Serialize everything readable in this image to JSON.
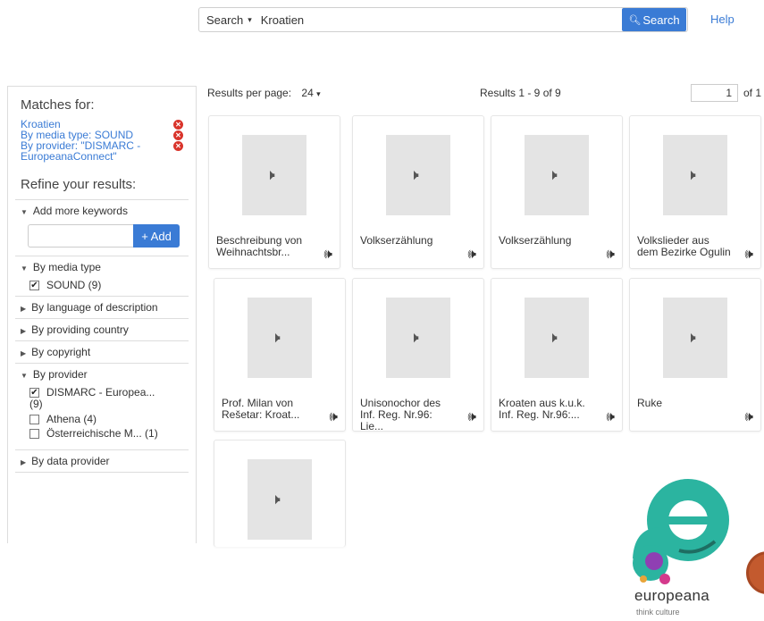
{
  "search": {
    "type_label": "Search",
    "query": "Kroatien",
    "button_label": "Search",
    "help_label": "Help"
  },
  "sidebar": {
    "matches_title": "Matches for:",
    "matches": [
      {
        "label": "Kroatien"
      },
      {
        "label": "By media type: SOUND"
      },
      {
        "label": "By provider: \"DISMARC - EuropeanaConnect\""
      }
    ],
    "refine_title": "Refine your results:",
    "facets": {
      "keywords": {
        "label": "Add more keywords",
        "add_label": "+ Add"
      },
      "media_type": {
        "label": "By media type",
        "options": [
          {
            "label": "SOUND (9)",
            "checked": true
          }
        ]
      },
      "language": {
        "label": "By language of description"
      },
      "country": {
        "label": "By providing country"
      },
      "copyright": {
        "label": "By copyright"
      },
      "provider": {
        "label": "By provider",
        "options": [
          {
            "label": "DISMARC - Europea...",
            "count": "(9)",
            "checked": true
          },
          {
            "label": "Athena (4)",
            "checked": false
          },
          {
            "label": "Österreichische M... (1)",
            "checked": false
          }
        ]
      },
      "data_provider": {
        "label": "By data provider"
      }
    }
  },
  "results_header": {
    "per_page_label": "Results per page:",
    "per_page_value": "24",
    "count_text": "Results  1 - 9 of 9",
    "page_value": "1",
    "page_of": "of 1"
  },
  "results": [
    {
      "title": "Beschreibung von Weihnachtsbr..."
    },
    {
      "title": "Volkserzählung"
    },
    {
      "title": "Volkserzählung"
    },
    {
      "title": "Volkslieder aus dem Bezirke Ogulin"
    },
    {
      "title": "Prof. Milan von Rešetar: Kroat..."
    },
    {
      "title": "Unisonochor des Inf. Reg. Nr.96: Lie..."
    },
    {
      "title": "Kroaten aus k.u.k. Inf. Reg. Nr.96:..."
    },
    {
      "title": "Ruke"
    },
    {
      "title": ""
    }
  ],
  "logo": {
    "name": "europeana",
    "tagline": "think culture"
  },
  "colors": {
    "accent": "#3a7bd5",
    "remove": "#d9342b",
    "logo_green": "#2bb4a0"
  }
}
